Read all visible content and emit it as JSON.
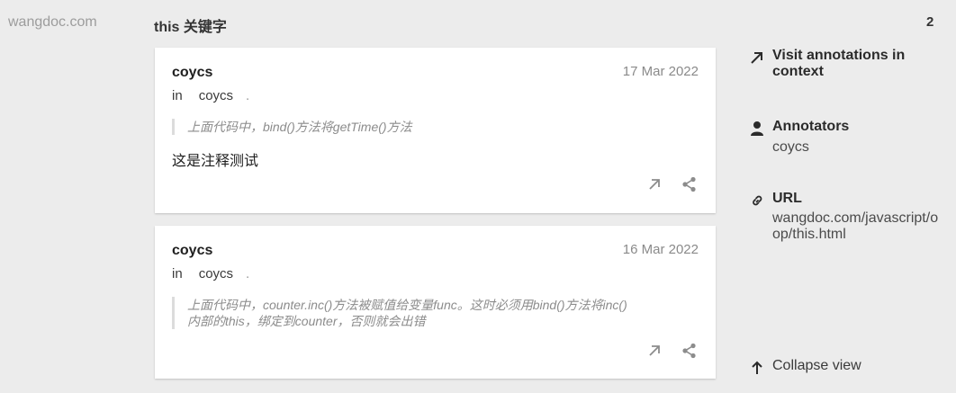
{
  "site": "wangdoc.com",
  "group_title": "this 关键字",
  "count": "2",
  "annotations": [
    {
      "user": "coycs",
      "date": "17 Mar 2022",
      "in_label": "in",
      "group": "coycs",
      "dot": ".",
      "quote": "上面代码中，bind()方法将getTime()方法",
      "text": "这是注释测试"
    },
    {
      "user": "coycs",
      "date": "16 Mar 2022",
      "in_label": "in",
      "group": "coycs",
      "dot": ".",
      "quote_line1": "上面代码中，counter.inc()方法被赋值给变量func。这时必须用bind()方法将inc()",
      "quote_line2": "内部的this，绑定到counter，否则就会出错"
    }
  ],
  "sidebar": {
    "visit_line1": "Visit annotations in",
    "visit_line2": "context",
    "annotators_title": "Annotators",
    "annotators_value": "coycs",
    "url_title": "URL",
    "url_line1": "wangdoc.com/javascript/o",
    "url_line2": "op/this.html",
    "collapse": "Collapse view"
  },
  "icons": {
    "visit": "arrow-up-right-icon",
    "annotators": "person-icon",
    "url": "link-icon",
    "collapse": "arrow-up-icon",
    "card_link": "arrow-up-right-icon",
    "card_share": "share-icon"
  }
}
